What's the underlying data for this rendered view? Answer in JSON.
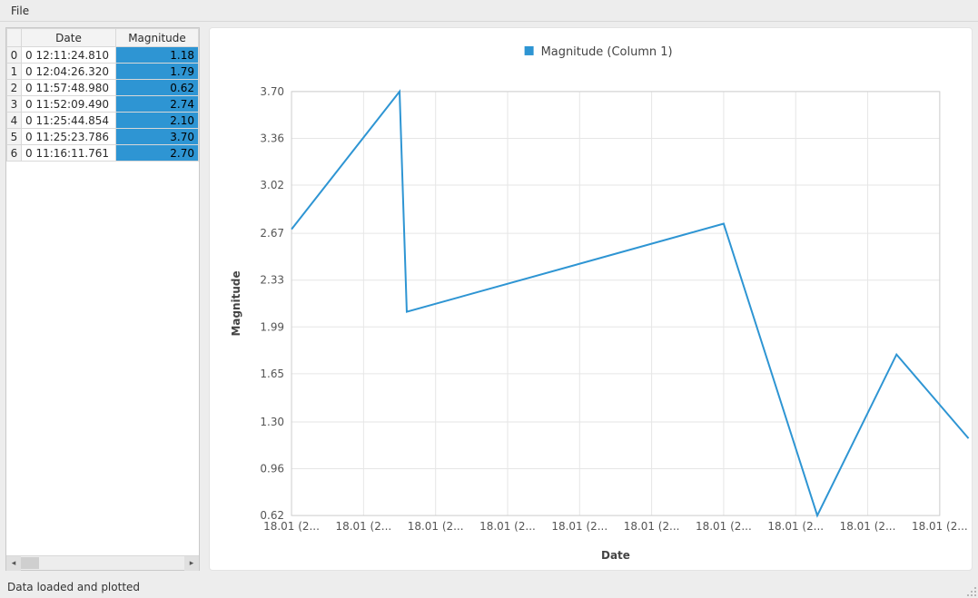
{
  "menu": {
    "file": "File"
  },
  "table": {
    "headers": [
      "Date",
      "Magnitude"
    ],
    "rows": [
      {
        "idx": "0",
        "date": "0 12:11:24.810",
        "mag": "1.18"
      },
      {
        "idx": "1",
        "date": "0 12:04:26.320",
        "mag": "1.79"
      },
      {
        "idx": "2",
        "date": "0 11:57:48.980",
        "mag": "0.62"
      },
      {
        "idx": "3",
        "date": "0 11:52:09.490",
        "mag": "2.74"
      },
      {
        "idx": "4",
        "date": "0 11:25:44.854",
        "mag": "2.10"
      },
      {
        "idx": "5",
        "date": "0 11:25:23.786",
        "mag": "3.70"
      },
      {
        "idx": "6",
        "date": "0 11:16:11.761",
        "mag": "2.70"
      }
    ],
    "selected_col": 1
  },
  "status": "Data loaded and plotted",
  "chart_data": {
    "type": "line",
    "title": "",
    "legend": "Magnitude (Column 1)",
    "xlabel": "Date",
    "ylabel": "Magnitude",
    "ylim": [
      0.62,
      3.7
    ],
    "yticks": [
      0.62,
      0.96,
      1.3,
      1.65,
      1.99,
      2.33,
      2.67,
      3.02,
      3.36,
      3.7
    ],
    "xticks": [
      "18.01 (2...",
      "18.01 (2...",
      "18.01 (2...",
      "18.01 (2...",
      "18.01 (2...",
      "18.01 (2...",
      "18.01 (2...",
      "18.01 (2...",
      "18.01 (2...",
      "18.01 (2..."
    ],
    "series": [
      {
        "name": "Magnitude (Column 1)",
        "values": [
          2.7,
          3.7,
          2.1,
          2.74,
          0.62,
          1.79,
          1.18
        ]
      }
    ],
    "colors": {
      "line": "#2e95d3",
      "grid": "#e6e6e6",
      "axis": "#cfcfcf",
      "text": "#555555"
    }
  }
}
